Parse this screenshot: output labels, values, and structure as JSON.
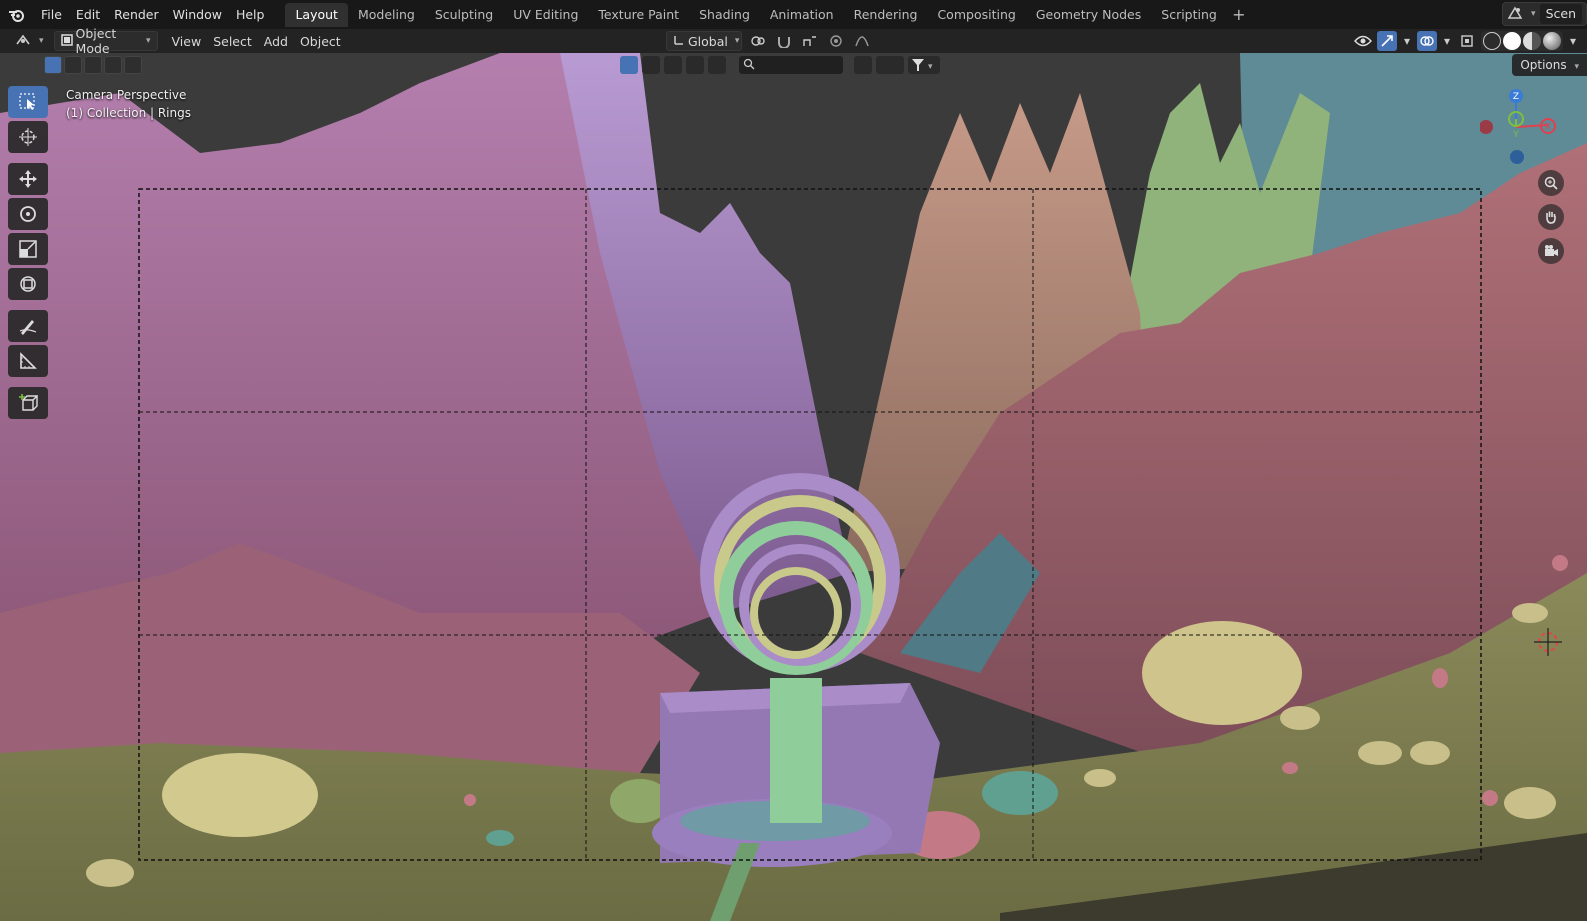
{
  "menu": [
    "File",
    "Edit",
    "Render",
    "Window",
    "Help"
  ],
  "workspaces": [
    {
      "label": "Layout",
      "active": true
    },
    {
      "label": "Modeling"
    },
    {
      "label": "Sculpting"
    },
    {
      "label": "UV Editing"
    },
    {
      "label": "Texture Paint"
    },
    {
      "label": "Shading"
    },
    {
      "label": "Animation"
    },
    {
      "label": "Rendering"
    },
    {
      "label": "Compositing"
    },
    {
      "label": "Geometry Nodes"
    },
    {
      "label": "Scripting"
    }
  ],
  "scene_name": "Scen",
  "header": {
    "mode": "Object Mode",
    "menus": [
      "View",
      "Select",
      "Add",
      "Object"
    ],
    "orientation": "Global"
  },
  "viewport": {
    "info_line1": "Camera Perspective",
    "info_line2": "(1) Collection | Rings",
    "options_label": "Options",
    "gizmo": {
      "z": "Z",
      "y": "Y",
      "x": "X"
    }
  },
  "colors": {
    "accent": "#4772b3",
    "axis_x": "#e0404f",
    "axis_y": "#7bc043",
    "axis_z": "#3b7bd8"
  }
}
